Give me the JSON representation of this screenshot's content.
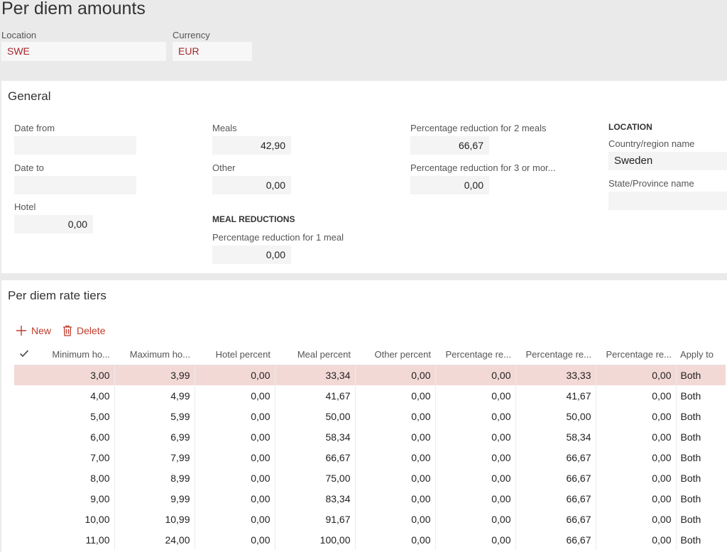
{
  "header": {
    "title": "Per diem amounts",
    "location_label": "Location",
    "location_value": "SWE",
    "currency_label": "Currency",
    "currency_value": "EUR"
  },
  "general": {
    "title": "General",
    "date_from_label": "Date from",
    "date_from_value": "",
    "date_to_label": "Date to",
    "date_to_value": "",
    "hotel_label": "Hotel",
    "hotel_value": "0,00",
    "meals_label": "Meals",
    "meals_value": "42,90",
    "other_label": "Other",
    "other_value": "0,00",
    "meal_reductions_heading": "MEAL REDUCTIONS",
    "reduction_1_label": "Percentage reduction for 1 meal",
    "reduction_1_value": "0,00",
    "reduction_2_label": "Percentage reduction for 2 meals",
    "reduction_2_value": "66,67",
    "reduction_3_label": "Percentage reduction for 3 or mor...",
    "reduction_3_value": "0,00",
    "location_heading": "LOCATION",
    "country_label": "Country/region name",
    "country_value": "Sweden",
    "state_label": "State/Province name",
    "state_value": ""
  },
  "tiers": {
    "title": "Per diem rate tiers",
    "new_label": "New",
    "delete_label": "Delete",
    "columns": [
      "Minimum ho...",
      "Maximum ho...",
      "Hotel percent",
      "Meal percent",
      "Other percent",
      "Percentage re...",
      "Percentage re...",
      "Percentage re...",
      "Apply to"
    ],
    "rows": [
      [
        "3,00",
        "3,99",
        "0,00",
        "33,34",
        "0,00",
        "0,00",
        "33,33",
        "0,00",
        "Both"
      ],
      [
        "4,00",
        "4,99",
        "0,00",
        "41,67",
        "0,00",
        "0,00",
        "41,67",
        "0,00",
        "Both"
      ],
      [
        "5,00",
        "5,99",
        "0,00",
        "50,00",
        "0,00",
        "0,00",
        "50,00",
        "0,00",
        "Both"
      ],
      [
        "6,00",
        "6,99",
        "0,00",
        "58,34",
        "0,00",
        "0,00",
        "58,34",
        "0,00",
        "Both"
      ],
      [
        "7,00",
        "7,99",
        "0,00",
        "66,67",
        "0,00",
        "0,00",
        "66,67",
        "0,00",
        "Both"
      ],
      [
        "8,00",
        "8,99",
        "0,00",
        "75,00",
        "0,00",
        "0,00",
        "66,67",
        "0,00",
        "Both"
      ],
      [
        "9,00",
        "9,99",
        "0,00",
        "83,34",
        "0,00",
        "0,00",
        "66,67",
        "0,00",
        "Both"
      ],
      [
        "10,00",
        "10,99",
        "0,00",
        "91,67",
        "0,00",
        "0,00",
        "66,67",
        "0,00",
        "Both"
      ],
      [
        "11,00",
        "24,00",
        "0,00",
        "100,00",
        "0,00",
        "0,00",
        "66,67",
        "0,00",
        "Both"
      ]
    ],
    "selected_row": 0
  },
  "colors": {
    "accent": "#c03b2b",
    "value_red": "#a4262c",
    "selected_row_bg": "#f3d9d6"
  }
}
